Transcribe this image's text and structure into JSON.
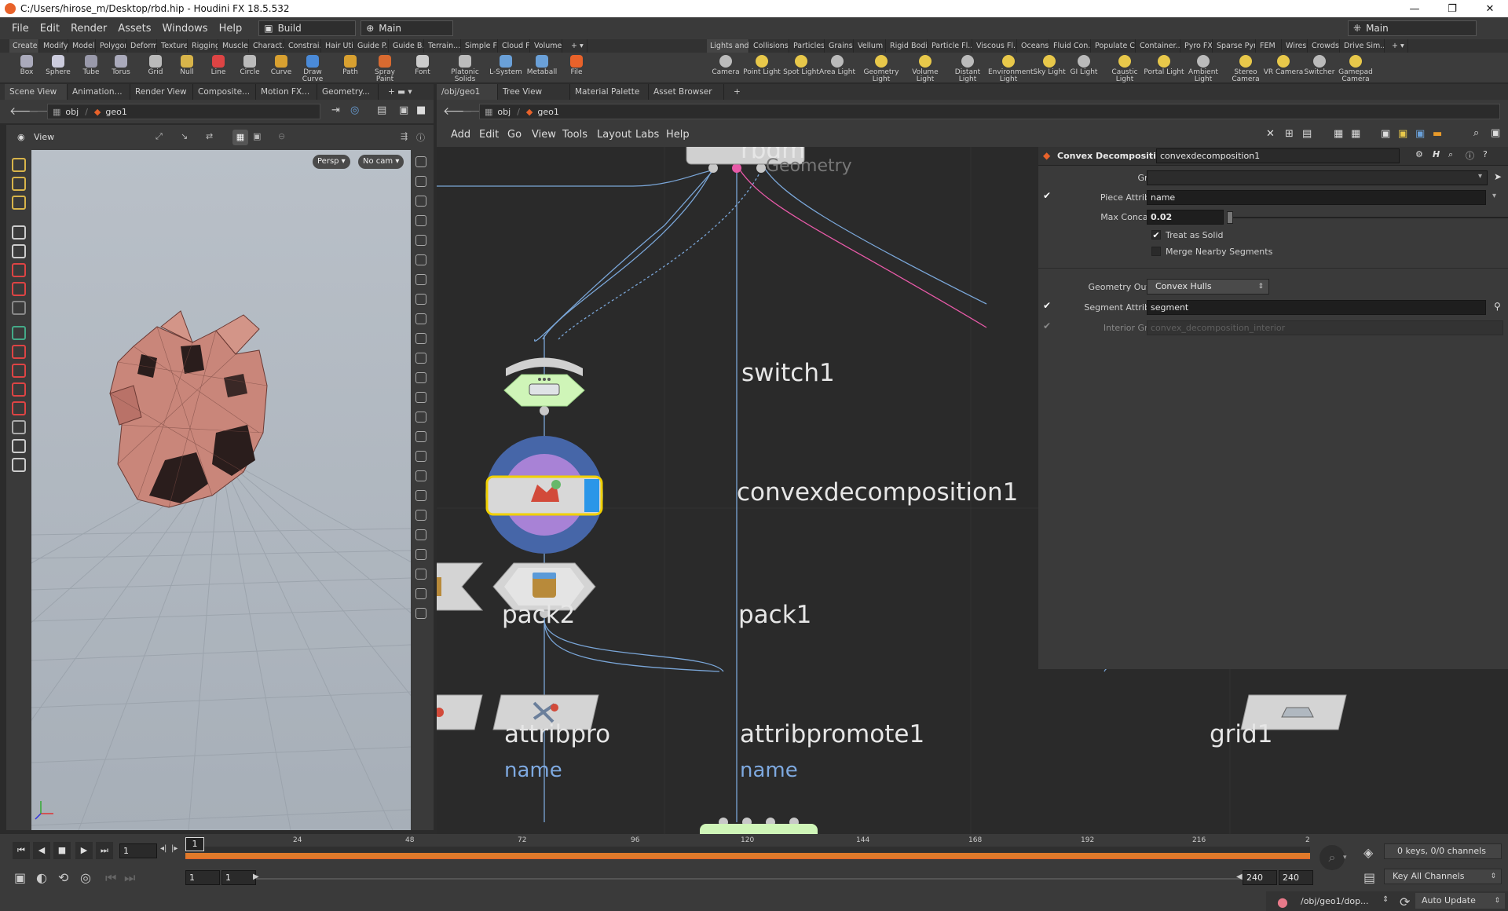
{
  "window": {
    "title": "C:/Users/hirose_m/Desktop/rbd.hip - Houdini FX 18.5.532",
    "controls": [
      "—",
      "❐",
      "✕"
    ]
  },
  "menubar": {
    "items": [
      "File",
      "Edit",
      "Render",
      "Assets",
      "Windows",
      "Help"
    ],
    "desktop": "Build",
    "scene": "Main",
    "right_desktop": "Main"
  },
  "shelf_tabs_left": [
    "Create",
    "Modify",
    "Model",
    "Polygon",
    "Deform",
    "Texture",
    "Rigging",
    "Muscles",
    "Charact...",
    "Constrai...",
    "Hair Utils",
    "Guide P...",
    "Guide B...",
    "Terrain...",
    "Simple FX",
    "Cloud FX",
    "Volume"
  ],
  "shelf_tabs_right": [
    "Lights and...",
    "Collisions",
    "Particles",
    "Grains",
    "Vellum",
    "Rigid Bodies",
    "Particle Fl...",
    "Viscous Fl...",
    "Oceans",
    "Fluid Con...",
    "Populate C...",
    "Container...",
    "Pyro FX",
    "Sparse Pyr...",
    "FEM",
    "Wires",
    "Crowds",
    "Drive Sim..."
  ],
  "tools_left": [
    "Box",
    "Sphere",
    "Tube",
    "Torus",
    "Grid",
    "Null",
    "Line",
    "Circle",
    "Curve",
    "Draw Curve",
    "Path",
    "Spray Paint",
    "Font",
    "Platonic Solids",
    "L-System",
    "Metaball",
    "File"
  ],
  "tools_right": [
    "Camera",
    "Point Light",
    "Spot Light",
    "Area Light",
    "Geometry Light",
    "Volume Light",
    "Distant Light",
    "Environment Light",
    "Sky Light",
    "GI Light",
    "Caustic Light",
    "Portal Light",
    "Ambient Light",
    "Stereo Camera",
    "VR Camera",
    "Switcher",
    "Gamepad Camera"
  ],
  "left_pane": {
    "tabs": [
      "Scene View",
      "Animation...",
      "Render View",
      "Composite...",
      "Motion FX...",
      "Geometry..."
    ],
    "path": [
      "obj",
      "geo1"
    ],
    "view_label": "View",
    "persp": "Persp ▾",
    "cam": "No cam ▾"
  },
  "network_pane": {
    "tabs": [
      "/obj/geo1",
      "Tree View",
      "Material Palette",
      "Asset Browser"
    ],
    "path": [
      "obj",
      "geo1"
    ],
    "menu": [
      "Add",
      "Edit",
      "Go",
      "View",
      "Tools",
      "Layout",
      "Labs",
      "Help"
    ],
    "nodes": {
      "switch": "switch1",
      "convex": "convexdecomposition1",
      "pack2": "pack2",
      "pack1": "pack1",
      "attrib_left": "attribpro",
      "attrib_right": "attribpromote1",
      "attrib_left_sub": "name",
      "attrib_right_sub": "name",
      "grid": "grid1",
      "top_partial": "rbdm",
      "top_sub": "Geometry"
    }
  },
  "params": {
    "node_type": "Convex Decomposition",
    "node_name": "convexdecomposition1",
    "group_label": "Group",
    "group_value": "",
    "piece_attr_label": "Piece Attribute",
    "piece_attr_value": "name",
    "max_concavity_label": "Max Concavity",
    "max_concavity_value": "0.02",
    "treat_solid": "Treat as Solid",
    "merge_nearby": "Merge Nearby Segments",
    "geo_output_label": "Geometry Output",
    "geo_output_value": "Convex Hulls",
    "segment_attr_label": "Segment Attribute",
    "segment_attr_value": "segment",
    "interior_group_label": "Interior Group",
    "interior_group_value": "convex_decomposition_interior"
  },
  "timeline": {
    "current_frame": "1",
    "ticks": [
      "24",
      "48",
      "72",
      "96",
      "120",
      "144",
      "168",
      "192",
      "216",
      "2"
    ],
    "start": "1",
    "start2": "1",
    "end": "240",
    "end2": "240",
    "frame_marker": "1",
    "keys": "0 keys, 0/0 channels",
    "key_all": "Key All Channels",
    "status_path": "/obj/geo1/dop...",
    "auto_update": "Auto Update"
  },
  "colors": {
    "accent_orange": "#e8622a",
    "node_green": "#cff5b8",
    "wire_blue": "#7aa6d8",
    "wire_pink": "#e85aa8",
    "selection_yellow": "#f0d000"
  }
}
